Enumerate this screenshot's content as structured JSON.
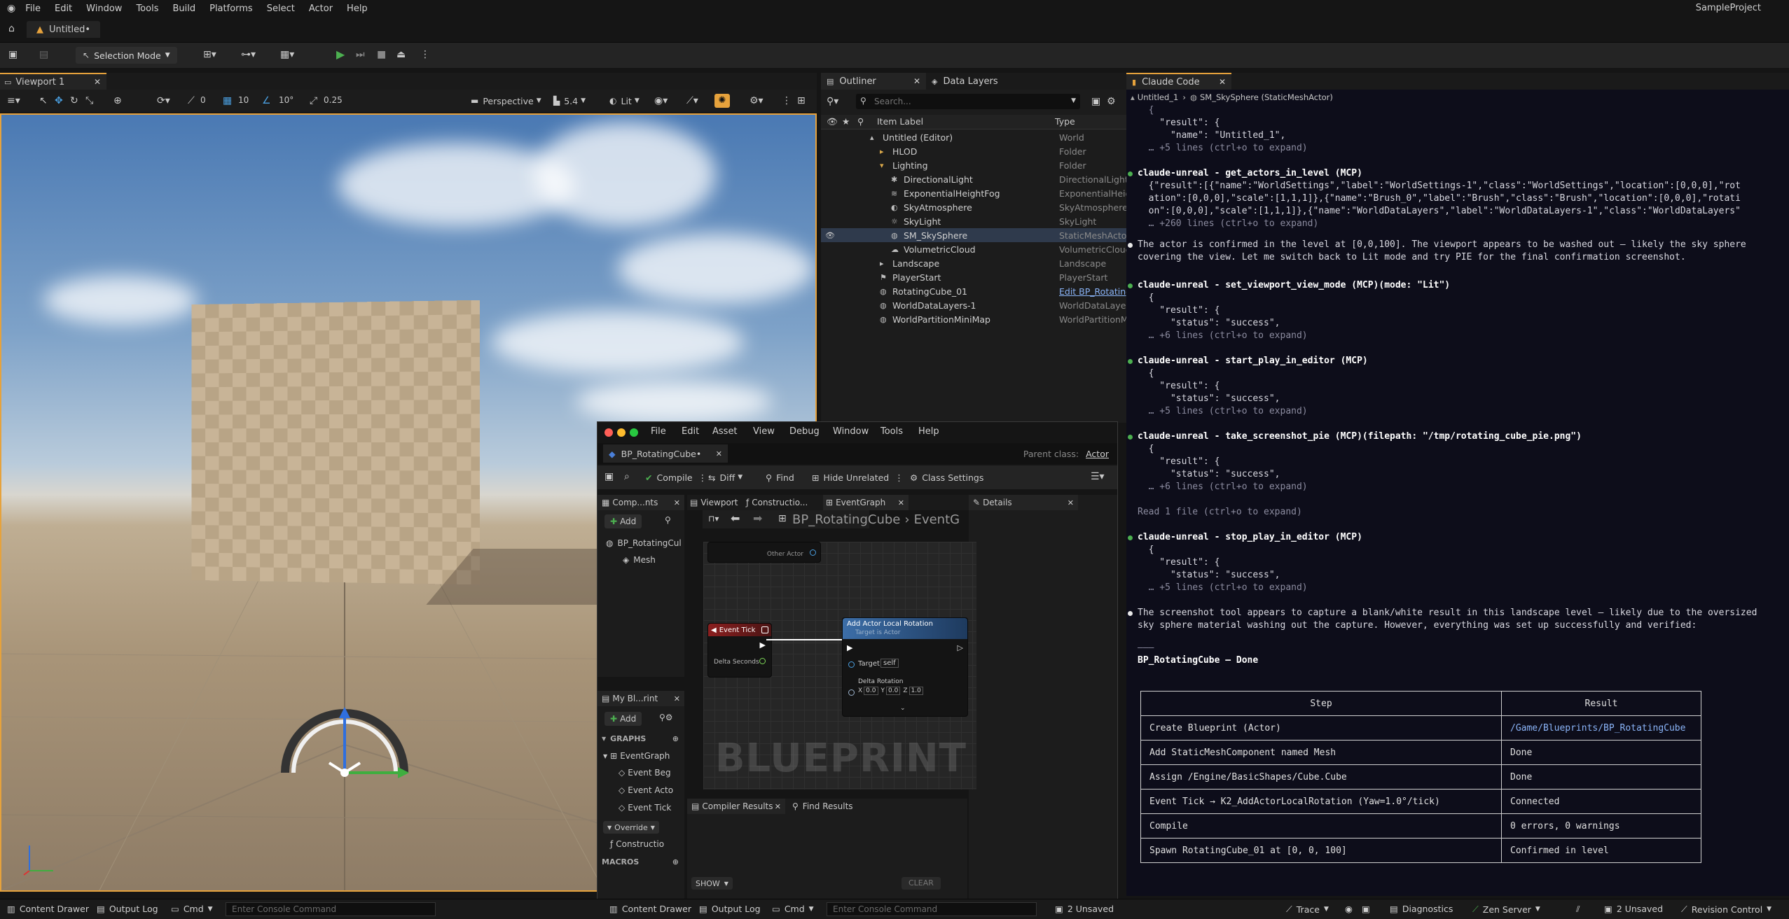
{
  "menu": [
    "File",
    "Edit",
    "Window",
    "Tools",
    "Build",
    "Platforms",
    "Select",
    "Actor",
    "Help"
  ],
  "project_name": "SampleProject",
  "doc_tab": "Untitled•",
  "toolbar": {
    "selection_mode": "Selection Mode"
  },
  "viewport": {
    "tab": "Viewport 1",
    "perspective": "Perspective",
    "lit": "Lit",
    "fov": "5.4",
    "snap_grid": "10",
    "snap_rot": "10°",
    "snap_scale": "0.25",
    "count": "0"
  },
  "outliner": {
    "tabs": [
      "Outliner",
      "Data Layers"
    ],
    "search_placeholder": "Search...",
    "col_label": "Item Label",
    "col_type": "Type",
    "rows": [
      {
        "label": "Untitled (Editor)",
        "type": "World"
      },
      {
        "label": "HLOD",
        "type": "Folder"
      },
      {
        "label": "Lighting",
        "type": "Folder"
      },
      {
        "label": "DirectionalLight",
        "type": "DirectionalLight"
      },
      {
        "label": "ExponentialHeightFog",
        "type": "ExponentialHeightFog"
      },
      {
        "label": "SkyAtmosphere",
        "type": "SkyAtmosphere"
      },
      {
        "label": "SkyLight",
        "type": "SkyLight"
      },
      {
        "label": "SM_SkySphere",
        "type": "StaticMeshActor"
      },
      {
        "label": "VolumetricCloud",
        "type": "VolumetricCloud"
      },
      {
        "label": "Landscape",
        "type": "Landscape"
      },
      {
        "label": "PlayerStart",
        "type": "PlayerStart"
      },
      {
        "label": "RotatingCube_01",
        "type": "Edit BP_Rotating"
      },
      {
        "label": "WorldDataLayers-1",
        "type": "WorldDataLayers"
      },
      {
        "label": "WorldPartitionMiniMap",
        "type": "WorldPartitionMi"
      }
    ]
  },
  "claude": {
    "tab": "Claude Code",
    "breadcrumb_a": "Untitled_1",
    "breadcrumb_b": "SM_SkySphere (StaticMeshActor)",
    "lines": [
      {
        "t": "  {",
        "c": "dim"
      },
      {
        "t": "    \"result\": {",
        "c": ""
      },
      {
        "t": "      \"name\": \"Untitled_1\",",
        "c": ""
      },
      {
        "t": "  … +5 lines (ctrl+o to expand)",
        "c": "dim"
      },
      {
        "t": "claude-unreal - get_actors_in_level (MCP)",
        "c": "b",
        "dot": "g"
      },
      {
        "t": "  {\"result\":[{\"name\":\"WorldSettings\",\"label\":\"WorldSettings-1\",\"class\":\"WorldSettings\",\"location\":[0,0,0],\"rot",
        "c": ""
      },
      {
        "t": "  ation\":[0,0,0],\"scale\":[1,1,1]},{\"name\":\"Brush_0\",\"label\":\"Brush\",\"class\":\"Brush\",\"location\":[0,0,0],\"rotati",
        "c": ""
      },
      {
        "t": "  on\":[0,0,0],\"scale\":[1,1,1]},{\"name\":\"WorldDataLayers\",\"label\":\"WorldDataLayers-1\",\"class\":\"WorldDataLayers\"",
        "c": ""
      },
      {
        "t": "  … +260 lines (ctrl+o to expand)",
        "c": "dim"
      },
      {
        "t": "The actor is confirmed in the level at [0,0,100]. The viewport appears to be washed out — likely the sky sphere",
        "c": "",
        "dot": "w"
      },
      {
        "t": "covering the view. Let me switch back to Lit mode and try PIE for the final confirmation screenshot.",
        "c": ""
      },
      {
        "t": "claude-unreal - set_viewport_view_mode (MCP)(mode: \"Lit\")",
        "c": "b",
        "dot": "g"
      },
      {
        "t": "  {",
        "c": ""
      },
      {
        "t": "    \"result\": {",
        "c": ""
      },
      {
        "t": "      \"status\": \"success\",",
        "c": ""
      },
      {
        "t": "  … +6 lines (ctrl+o to expand)",
        "c": "dim"
      },
      {
        "t": "claude-unreal - start_play_in_editor (MCP)",
        "c": "b",
        "dot": "g"
      },
      {
        "t": "  {",
        "c": ""
      },
      {
        "t": "    \"result\": {",
        "c": ""
      },
      {
        "t": "      \"status\": \"success\",",
        "c": ""
      },
      {
        "t": "  … +5 lines (ctrl+o to expand)",
        "c": "dim"
      },
      {
        "t": "claude-unreal - take_screenshot_pie (MCP)(filepath: \"/tmp/rotating_cube_pie.png\")",
        "c": "b",
        "dot": "g"
      },
      {
        "t": "  {",
        "c": ""
      },
      {
        "t": "    \"result\": {",
        "c": ""
      },
      {
        "t": "      \"status\": \"success\",",
        "c": ""
      },
      {
        "t": "  … +6 lines (ctrl+o to expand)",
        "c": "dim"
      },
      {
        "t": "Read 1 file (ctrl+o to expand)",
        "c": "dim"
      },
      {
        "t": "claude-unreal - stop_play_in_editor (MCP)",
        "c": "b",
        "dot": "g"
      },
      {
        "t": "  {",
        "c": ""
      },
      {
        "t": "    \"result\": {",
        "c": ""
      },
      {
        "t": "      \"status\": \"success\",",
        "c": ""
      },
      {
        "t": "  … +5 lines (ctrl+o to expand)",
        "c": "dim"
      },
      {
        "t": "The screenshot tool appears to capture a blank/white result in this landscape level — likely due to the oversized",
        "c": "",
        "dot": "w"
      },
      {
        "t": "sky sphere material washing out the capture. However, everything was set up successfully and verified:",
        "c": ""
      },
      {
        "t": "———",
        "c": "dim"
      },
      {
        "t": "BP_RotatingCube — Done",
        "c": "b"
      }
    ],
    "table_head": [
      "Step",
      "Result"
    ],
    "table_rows": [
      [
        "Create Blueprint (Actor)",
        "/Game/Blueprints/BP_RotatingCube"
      ],
      [
        "Add StaticMeshComponent named Mesh",
        "Done"
      ],
      [
        "Assign /Engine/BasicShapes/Cube.Cube",
        "Done"
      ],
      [
        "Event Tick → K2_AddActorLocalRotation (Yaw=1.0°/tick)",
        "Connected"
      ],
      [
        "Compile",
        "0 errors, 0 warnings"
      ],
      [
        "Spawn RotatingCube_01 at [0, 0, 100]",
        "Confirmed in level"
      ]
    ]
  },
  "bp": {
    "menu": [
      "File",
      "Edit",
      "Asset",
      "View",
      "Debug",
      "Window",
      "Tools",
      "Help"
    ],
    "tab": "BP_RotatingCube•",
    "parent_class_label": "Parent class:",
    "parent_class": "Actor",
    "compile": "Compile",
    "diff": "Diff",
    "find": "Find",
    "hide_unrelated": "Hide Unrelated",
    "class_settings": "Class Settings",
    "components_tab": "Comp...nts",
    "add": "Add",
    "components": [
      "BP_RotatingCul",
      "Mesh"
    ],
    "graph_tabs": [
      "Viewport",
      "Constructio...",
      "EventGraph"
    ],
    "details_tab": "Details",
    "breadcrumb_a": "BP_RotatingCube",
    "breadcrumb_b": "EventG",
    "other_actor": "Other Actor",
    "event_tick": "Event Tick",
    "delta_seconds": "Delta Seconds",
    "add_rot_title": "Add Actor Local Rotation",
    "add_rot_sub": "Target is Actor",
    "target": "Target",
    "self": "self",
    "delta_rotation": "Delta Rotation",
    "rx": "0.0",
    "ry": "0.0",
    "rz": "1.0",
    "watermark": "BLUEPRINT",
    "mybp_tab": "My Bl...rint",
    "graphs_label": "GRAPHS",
    "eventgraph": "EventGraph",
    "events": [
      "Event Beg",
      "Event Acto",
      "Event Tick"
    ],
    "override": "Override",
    "construction": "Constructio",
    "macros": "MACROS",
    "compiler_results": "Compiler Results",
    "find_results": "Find Results",
    "show": "SHOW",
    "clear": "CLEAR"
  },
  "status": {
    "content_drawer": "Content Drawer",
    "output_log": "Output Log",
    "cmd": "Cmd",
    "console_placeholder": "Enter Console Command",
    "unsaved_bp": "2 Unsaved",
    "trace": "Trace",
    "diagnostics": "Diagnostics",
    "zen": "Zen Server",
    "unsaved": "2 Unsaved",
    "revision": "Revision Control"
  }
}
